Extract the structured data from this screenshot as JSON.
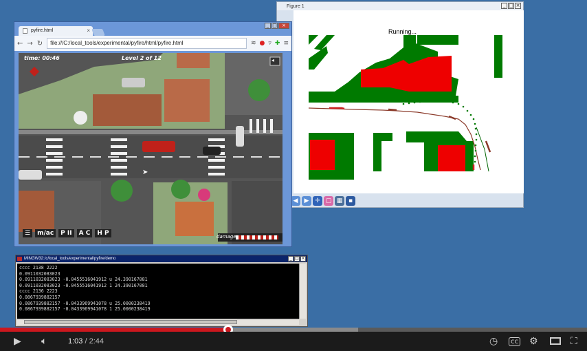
{
  "figure_window": {
    "title": "Figure 1",
    "status": "Running...",
    "toolbar_icons": [
      "back-icon",
      "forward-icon",
      "pan-icon",
      "zoom-icon",
      "subplots-icon",
      "save-icon"
    ]
  },
  "browser_window": {
    "tab_title": "pyfire.html",
    "address": "file:///C:/local_tools/experimental/pyfire/html/pyfire.html",
    "game": {
      "time_label": "time: 00:46",
      "level_label": "Level 2 of 12",
      "damage_label": "damage",
      "bottom_buttons": [
        "☰",
        "m/ac",
        "P II",
        "A C",
        "H P"
      ]
    }
  },
  "terminal_window": {
    "title": "MINGW32:/c/local_tools/experimental/pyfire/demo",
    "lines": [
      "cccc 2138 2222",
      "0.0911032083023",
      "0.0911032083023 -0.0455516041912 u 24.390167081",
      "0.0911032083023 -0.0455516041912 1 24.390167081",
      "cccc 2136 2223",
      "0.0867939882157",
      "0.0867939882157 -0.0433969941078 u 25.0000238419",
      "0.0867939882157 -0.0433969941078 1 25.0000238419"
    ]
  },
  "player": {
    "current_time": "1:03",
    "duration": "2:44",
    "played_fraction": 0.389,
    "buffered_fraction": 0.61,
    "colors": {
      "progress": "#cc181e",
      "bar": "#1b1b1b"
    }
  }
}
